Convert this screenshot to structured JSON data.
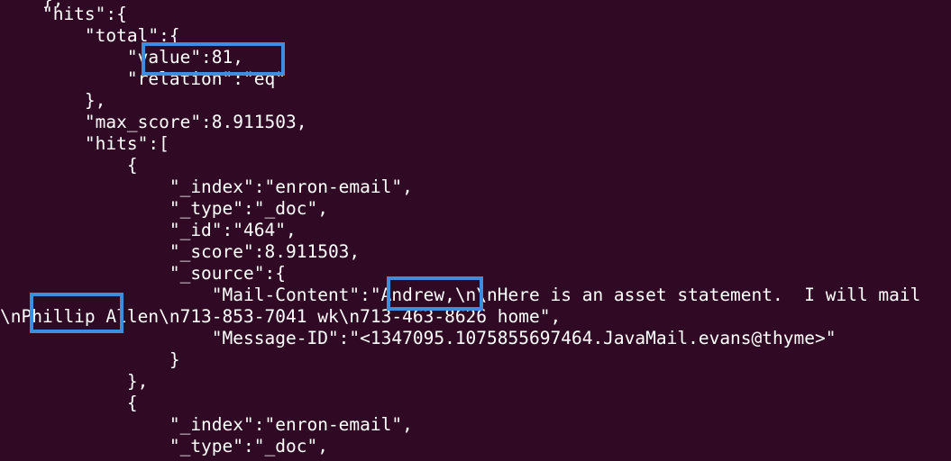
{
  "terminal": {
    "lines": [
      "    },",
      "    \"hits\":{",
      "        \"total\":{",
      "            \"value\":81,",
      "            \"relation\":\"eq\"",
      "        },",
      "        \"max_score\":8.911503,",
      "        \"hits\":[",
      "            {",
      "                \"_index\":\"enron-email\",",
      "                \"_type\":\"_doc\",",
      "                \"_id\":\"464\",",
      "                \"_score\":8.911503,",
      "                \"_source\":{",
      "                    \"Mail-Content\":\"Andrew,\\n\\nHere is an asset statement.  I will mail",
      "\\nPhillip Allen\\n713-853-7041 wk\\n713-463-8626 home\",",
      "                    \"Message-ID\":\"<1347095.1075855697464.JavaMail.evans@thyme>\"",
      "                }",
      "            },",
      "            {",
      "                \"_index\":\"enron-email\",",
      "                \"_type\":\"_doc\","
    ],
    "highlights": [
      "value-81",
      "andrew",
      "phillip"
    ],
    "colors": {
      "background": "#300a24",
      "text": "#ffffff",
      "highlight_border": "#3d8ee0"
    }
  }
}
